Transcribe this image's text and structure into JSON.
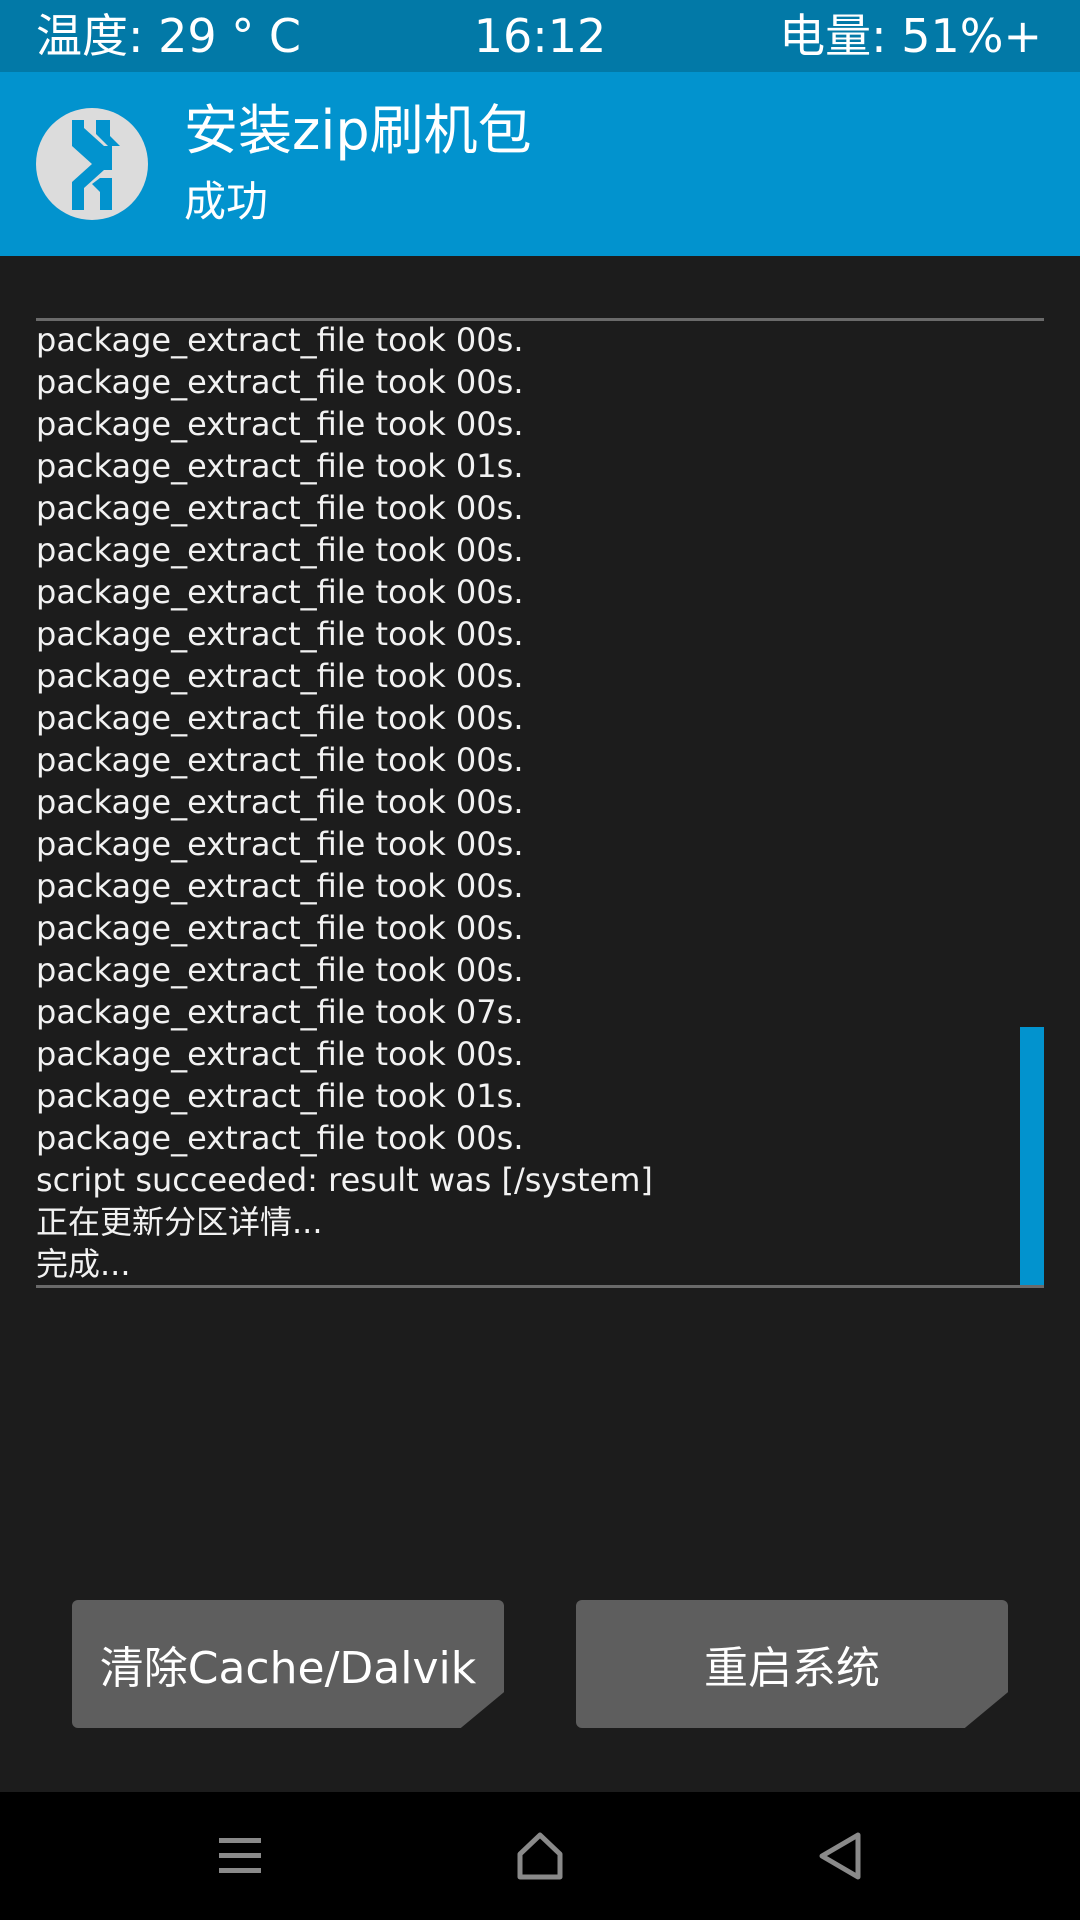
{
  "statusbar": {
    "temperature": "温度: 29 ° C",
    "time": "16:12",
    "battery": "电量: 51%+"
  },
  "header": {
    "title": "安装zip刷机包",
    "subtitle": "成功"
  },
  "console": {
    "lines": [
      "package_extract_file took 00s.",
      "package_extract_file took 00s.",
      "package_extract_file took 00s.",
      "package_extract_file took 01s.",
      "package_extract_file took 00s.",
      "package_extract_file took 00s.",
      "package_extract_file took 00s.",
      "package_extract_file took 00s.",
      "package_extract_file took 00s.",
      "package_extract_file took 00s.",
      "package_extract_file took 00s.",
      "package_extract_file took 00s.",
      "package_extract_file took 00s.",
      "package_extract_file took 00s.",
      "package_extract_file took 00s.",
      "package_extract_file took 00s.",
      "package_extract_file took 07s.",
      "package_extract_file took 00s.",
      "package_extract_file took 01s.",
      "package_extract_file took 00s.",
      "script succeeded: result was [/system]",
      "正在更新分区详情...",
      "完成..."
    ]
  },
  "buttons": {
    "wipe_label": "清除Cache/Dalvik",
    "reboot_label": "重启系统"
  },
  "icons": {
    "logo": "twrp-logo-icon",
    "menu": "menu-icon",
    "home": "home-icon",
    "back": "back-icon"
  },
  "colors": {
    "statusbar": "#0279a7",
    "header": "#0293ce",
    "background": "#1c1c1c",
    "button": "#5e5e5e",
    "accent": "#0293ce"
  }
}
